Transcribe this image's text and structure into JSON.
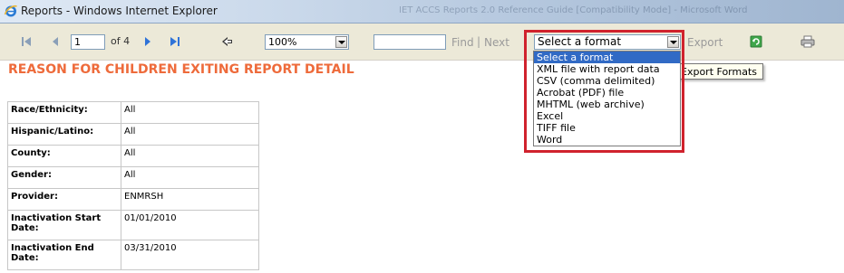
{
  "window": {
    "title": "Reports - Windows Internet Explorer",
    "ghost_title": "IET ACCS Reports 2.0 Reference Guide [Compatibility Mode] - Microsoft Word"
  },
  "toolbar": {
    "page_current": "1",
    "page_of": "of 4",
    "zoom": "100%",
    "find_placeholder": "",
    "find_label": "Find",
    "separator": "|",
    "next_label": "Next",
    "export_select_value": "Select a format",
    "export_label": "Export",
    "icons": {
      "first": "first-page-icon",
      "prev": "previous-page-icon",
      "next": "next-page-icon",
      "last": "last-page-icon",
      "back": "back-to-parent-icon",
      "refresh": "refresh-icon",
      "print": "print-icon"
    }
  },
  "export_dropdown": {
    "options": [
      "Select a format",
      "XML file with report data",
      "CSV (comma delimited)",
      "Acrobat (PDF) file",
      "MHTML (web archive)",
      "Excel",
      "TIFF file",
      "Word"
    ],
    "selected_index": 0
  },
  "tooltip": "Export Formats",
  "report": {
    "title": "REASON FOR CHILDREN EXITING REPORT DETAIL",
    "parameters": [
      {
        "label": "Race/Ethnicity:",
        "value": "All"
      },
      {
        "label": "Hispanic/Latino:",
        "value": "All"
      },
      {
        "label": "County:",
        "value": "All"
      },
      {
        "label": "Gender:",
        "value": "All"
      },
      {
        "label": "Provider:",
        "value": "ENMRSH"
      },
      {
        "label": "Inactivation Start Date:",
        "value": "01/01/2010"
      },
      {
        "label": "Inactivation End Date:",
        "value": "03/31/2010"
      }
    ]
  },
  "colors": {
    "accent_title": "#ee6b3b",
    "highlight_border": "#d0222d",
    "selection": "#316ac5",
    "toolbar_bg": "#ece9d8"
  }
}
